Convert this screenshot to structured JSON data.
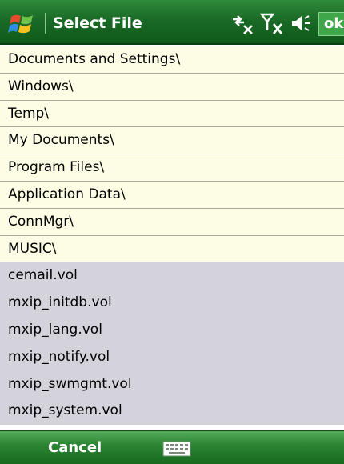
{
  "title_bar": {
    "title": "Select File",
    "ok_label": "ok",
    "icons": [
      "windows-start-icon",
      "connectivity-icon",
      "signal-off-icon",
      "speaker-icon"
    ]
  },
  "file_list": {
    "folders": [
      "Documents and Settings\\",
      "Windows\\",
      "Temp\\",
      "My Documents\\",
      "Program Files\\",
      "Application Data\\",
      "ConnMgr\\",
      "MUSIC\\"
    ],
    "files": [
      "cemail.vol",
      "mxip_initdb.vol",
      "mxip_lang.vol",
      "mxip_notify.vol",
      "mxip_swmgmt.vol",
      "mxip_system.vol"
    ]
  },
  "softkeys": {
    "left_label": "Cancel",
    "input_icon": "keyboard-icon"
  },
  "colors": {
    "titlebar": "#1b6a26",
    "folder_row": "#fdfde5",
    "file_row": "#d4d3dc",
    "softkey_bar": "#2d8634"
  }
}
